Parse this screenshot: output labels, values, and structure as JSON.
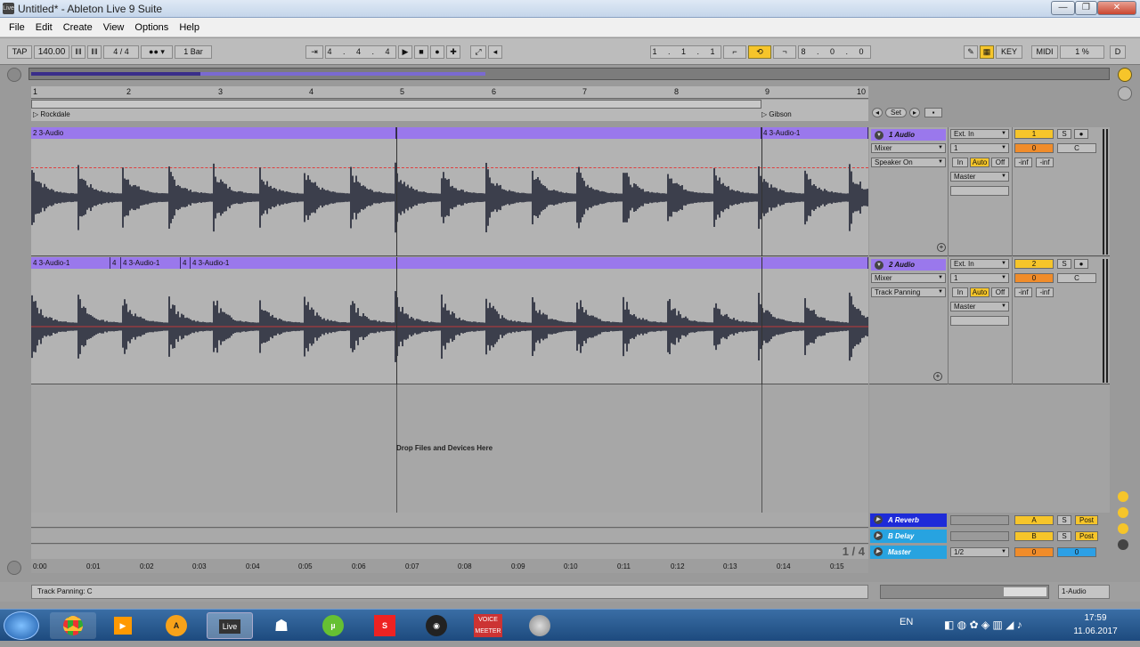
{
  "window": {
    "title": "Untitled* - Ableton Live 9 Suite",
    "buttons": [
      "—",
      "❐",
      "✕"
    ]
  },
  "menu": [
    "File",
    "Edit",
    "Create",
    "View",
    "Options",
    "Help"
  ],
  "transport": {
    "tap": "TAP",
    "tempo": "140.00",
    "meter": "4 / 4",
    "quantize": "1 Bar",
    "position": "4 . 4 . 4",
    "loop_start": "1 . 1 . 1",
    "loop_length": "8 . 0 . 0",
    "key": "KEY",
    "midi": "MIDI",
    "cpu": "1 %",
    "d": "D"
  },
  "ruler": {
    "bars": [
      "1",
      "2",
      "3",
      "4",
      "5",
      "6",
      "7",
      "8",
      "9",
      "10"
    ]
  },
  "locators": {
    "left": "Rockdale",
    "right": "Gibson",
    "set": "Set"
  },
  "tracks": [
    {
      "name": "1 Audio",
      "clips": [
        "2 3-Audio",
        "",
        "4 3-Audio-1"
      ],
      "input_type": "Ext. In",
      "input_channel": "1",
      "device": "Mixer",
      "automation": "Speaker On",
      "monitor": [
        "In",
        "Auto",
        "Off"
      ],
      "output": "Master",
      "number": "1",
      "volume": "0",
      "pan": "C",
      "s": "S",
      "send_a": "-inf",
      "send_b": "-inf"
    },
    {
      "name": "2 Audio",
      "clips": [
        "4 3-Audio-1",
        "4",
        "4 3-Audio-1",
        "4",
        "4 3-Audio-1"
      ],
      "input_type": "Ext. In",
      "input_channel": "1",
      "device": "Mixer",
      "automation": "Track Panning",
      "monitor": [
        "In",
        "Auto",
        "Off"
      ],
      "output": "Master",
      "number": "2",
      "volume": "0",
      "pan": "C",
      "s": "S",
      "send_a": "-inf",
      "send_b": "-inf"
    }
  ],
  "drop_area": {
    "text": "Drop Files and Devices Here",
    "page": "1 / 4"
  },
  "returns": [
    {
      "name": "A Reverb",
      "letter": "A",
      "post": "Post",
      "s": "S",
      "color": "#1e2bd8"
    },
    {
      "name": "B Delay",
      "letter": "B",
      "post": "Post",
      "s": "S",
      "color": "#27a3e0"
    },
    {
      "name": "Master",
      "letter": "0",
      "post": "",
      "s": "",
      "color": "#27a3e0",
      "output": "1/2",
      "vol": "0"
    }
  ],
  "timeline": [
    "0:00",
    "0:01",
    "0:02",
    "0:03",
    "0:04",
    "0:05",
    "0:06",
    "0:07",
    "0:08",
    "0:09",
    "0:10",
    "0:11",
    "0:12",
    "0:13",
    "0:14",
    "0:15"
  ],
  "status": {
    "text": "Track Panning: C",
    "track": "1-Audio"
  },
  "taskbar": {
    "apps": [
      "Chrome",
      "Media",
      "AIMP",
      "Live",
      "CS",
      "uTorrent",
      "Foobar",
      "OBS",
      "VOICEMEETER",
      "Disk"
    ],
    "lang": "EN",
    "time": "17:59",
    "date": "11.06.2017"
  },
  "colors": {
    "clip": "#9a78ec",
    "yellow": "#f6c52a",
    "orange": "#f08c2a",
    "blue": "#2ca0e6"
  }
}
